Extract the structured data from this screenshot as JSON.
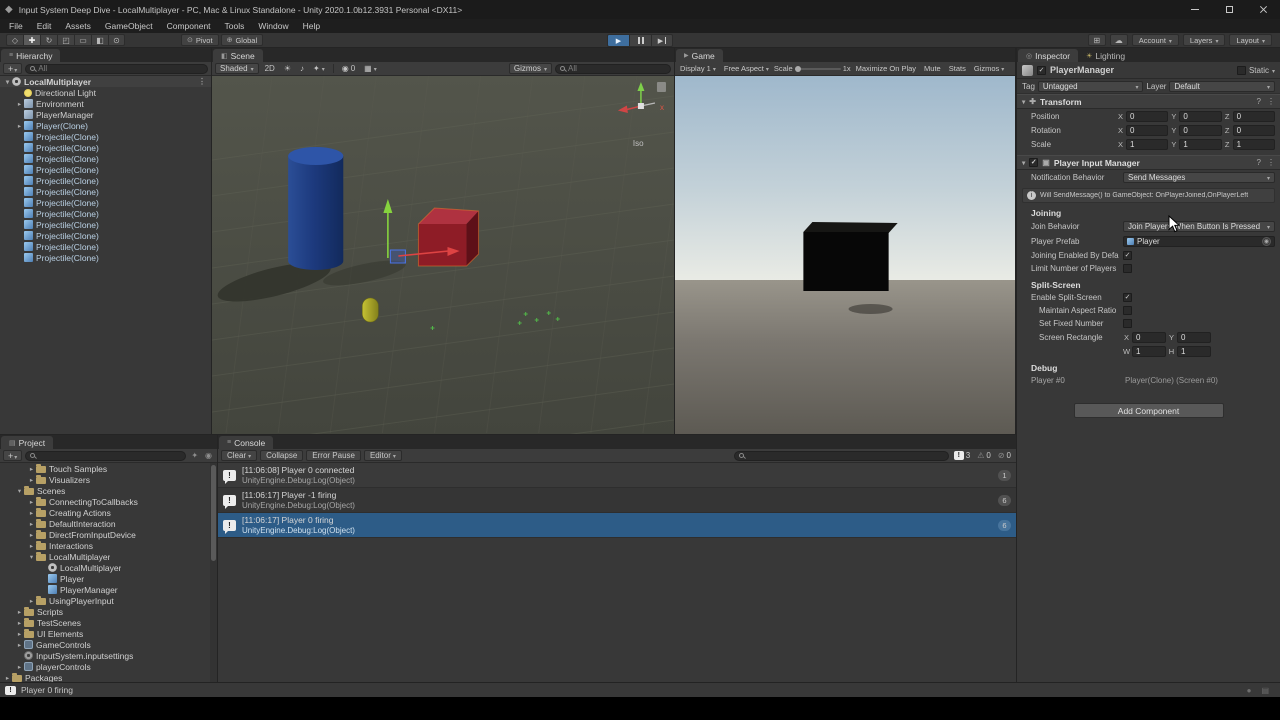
{
  "window": {
    "title": "Input System Deep Dive - LocalMultiplayer - PC, Mac & Linux Standalone - Unity 2020.1.0b12.3931 Personal <DX11>"
  },
  "menubar": {
    "items": [
      {
        "label": "File"
      },
      {
        "label": "Edit"
      },
      {
        "label": "Assets"
      },
      {
        "label": "GameObject"
      },
      {
        "label": "Component"
      },
      {
        "label": "Tools"
      },
      {
        "label": "Window"
      },
      {
        "label": "Help"
      }
    ]
  },
  "toolbar": {
    "pivot": "Pivot",
    "global": "Global",
    "account": "Account",
    "layers": "Layers",
    "layout": "Layout"
  },
  "hierarchy": {
    "tab": "Hierarchy",
    "add_button": "+",
    "search_placeholder": "All",
    "items": [
      {
        "label": "LocalMultiplayer",
        "cls": "ind-0 scene-row",
        "arrow": "a-open",
        "icon": "i-scene"
      },
      {
        "label": "Directional Light",
        "cls": "ind-1",
        "arrow": "a-none",
        "icon": "i-light"
      },
      {
        "label": "Environment",
        "cls": "ind-1",
        "arrow": "a-closed",
        "icon": "i-go"
      },
      {
        "label": "PlayerManager",
        "cls": "ind-1",
        "arrow": "a-none",
        "icon": "i-go"
      },
      {
        "label": "Player(Clone)",
        "cls": "ind-1 ptext",
        "arrow": "a-closed",
        "icon": "i-prefab"
      },
      {
        "label": "Projectile(Clone)",
        "cls": "ind-1 ptext",
        "arrow": "a-none",
        "icon": "i-prefab"
      },
      {
        "label": "Projectile(Clone)",
        "cls": "ind-1 ptext",
        "arrow": "a-none",
        "icon": "i-prefab"
      },
      {
        "label": "Projectile(Clone)",
        "cls": "ind-1 ptext",
        "arrow": "a-none",
        "icon": "i-prefab"
      },
      {
        "label": "Projectile(Clone)",
        "cls": "ind-1 ptext",
        "arrow": "a-none",
        "icon": "i-prefab"
      },
      {
        "label": "Projectile(Clone)",
        "cls": "ind-1 ptext",
        "arrow": "a-none",
        "icon": "i-prefab"
      },
      {
        "label": "Projectile(Clone)",
        "cls": "ind-1 ptext",
        "arrow": "a-none",
        "icon": "i-prefab"
      },
      {
        "label": "Projectile(Clone)",
        "cls": "ind-1 ptext",
        "arrow": "a-none",
        "icon": "i-prefab"
      },
      {
        "label": "Projectile(Clone)",
        "cls": "ind-1 ptext",
        "arrow": "a-none",
        "icon": "i-prefab"
      },
      {
        "label": "Projectile(Clone)",
        "cls": "ind-1 ptext",
        "arrow": "a-none",
        "icon": "i-prefab"
      },
      {
        "label": "Projectile(Clone)",
        "cls": "ind-1 ptext",
        "arrow": "a-none",
        "icon": "i-prefab"
      },
      {
        "label": "Projectile(Clone)",
        "cls": "ind-1 ptext",
        "arrow": "a-none",
        "icon": "i-prefab"
      },
      {
        "label": "Projectile(Clone)",
        "cls": "ind-1 ptext",
        "arrow": "a-none",
        "icon": "i-prefab"
      }
    ]
  },
  "project": {
    "tab": "Project",
    "add_button": "+",
    "items": [
      {
        "label": "Touch Samples",
        "cls": "ind-2",
        "arrow": "a-closed",
        "icon": "i-folder"
      },
      {
        "label": "Visualizers",
        "cls": "ind-2",
        "arrow": "a-closed",
        "icon": "i-folder"
      },
      {
        "label": "Scenes",
        "cls": "ind-1",
        "arrow": "a-open",
        "icon": "i-folder"
      },
      {
        "label": "ConnectingToCallbacks",
        "cls": "ind-2",
        "arrow": "a-closed",
        "icon": "i-folder"
      },
      {
        "label": "Creating Actions",
        "cls": "ind-2",
        "arrow": "a-closed",
        "icon": "i-folder"
      },
      {
        "label": "DefaultInteraction",
        "cls": "ind-2",
        "arrow": "a-closed",
        "icon": "i-folder"
      },
      {
        "label": "DirectFromInputDevice",
        "cls": "ind-2",
        "arrow": "a-closed",
        "icon": "i-folder"
      },
      {
        "label": "Interactions",
        "cls": "ind-2",
        "arrow": "a-closed",
        "icon": "i-folder"
      },
      {
        "label": "LocalMultiplayer",
        "cls": "ind-2",
        "arrow": "a-open",
        "icon": "i-folder"
      },
      {
        "label": "LocalMultiplayer",
        "cls": "ind-3",
        "arrow": "a-none",
        "icon": "i-scene"
      },
      {
        "label": "Player",
        "cls": "ind-3",
        "arrow": "a-none",
        "icon": "i-prefab"
      },
      {
        "label": "PlayerManager",
        "cls": "ind-3",
        "arrow": "a-none",
        "icon": "i-prefab"
      },
      {
        "label": "UsingPlayerInput",
        "cls": "ind-2",
        "arrow": "a-closed",
        "icon": "i-folder"
      },
      {
        "label": "Scripts",
        "cls": "ind-1",
        "arrow": "a-closed",
        "icon": "i-folder"
      },
      {
        "label": "TestScenes",
        "cls": "ind-1",
        "arrow": "a-closed",
        "icon": "i-folder"
      },
      {
        "label": "UI Elements",
        "cls": "ind-1",
        "arrow": "a-closed",
        "icon": "i-folder"
      },
      {
        "label": "GameControls",
        "cls": "ind-1",
        "arrow": "a-closed",
        "icon": "i-asset"
      },
      {
        "label": "InputSystem.inputsettings",
        "cls": "ind-1",
        "arrow": "a-none",
        "icon": "i-gear"
      },
      {
        "label": "playerControls",
        "cls": "ind-1",
        "arrow": "a-closed",
        "icon": "i-asset"
      },
      {
        "label": "Packages",
        "cls": "ind-0",
        "arrow": "a-closed",
        "icon": "i-folder"
      }
    ]
  },
  "scene": {
    "tab": "Scene",
    "shading": "Shaded",
    "mode_2d": "2D",
    "hidden_count": "0",
    "gizmos": "Gizmos",
    "search_placeholder": "All",
    "iso_label": "Iso",
    "axis_x_label": "x"
  },
  "game": {
    "tab": "Game",
    "display": "Display 1",
    "aspect": "Free Aspect",
    "scale_label": "Scale",
    "scale_value": "1x",
    "maximize": "Maximize On Play",
    "mute": "Mute",
    "stats": "Stats",
    "gizmos": "Gizmos"
  },
  "console": {
    "tab": "Console",
    "clear": "Clear",
    "collapse": "Collapse",
    "error_pause": "Error Pause",
    "editor": "Editor",
    "counts": {
      "info": "3",
      "warning": "0",
      "error": "0"
    },
    "logs": [
      {
        "line1": "[11:06:08] Player 0 connected",
        "line2": "UnityEngine.Debug:Log(Object)",
        "count": "1",
        "cls": ""
      },
      {
        "line1": "[11:06:17] Player -1 firing",
        "line2": "UnityEngine.Debug:Log(Object)",
        "count": "6",
        "cls": ""
      },
      {
        "line1": "[11:06:17] Player 0 firing",
        "line2": "UnityEngine.Debug:Log(Object)",
        "count": "6",
        "cls": "selected"
      }
    ]
  },
  "inspector": {
    "tab": "Inspector",
    "tab_lighting": "Lighting",
    "name": "PlayerManager",
    "active_check": "✓",
    "static_label": "Static",
    "static_check": "",
    "tag_label": "Tag",
    "tag_value": "Untagged",
    "layer_label": "Layer",
    "layer_value": "Default",
    "transform": {
      "title": "Transform",
      "axes": {
        "x": "X",
        "y": "Y",
        "z": "Z"
      },
      "rows": [
        {
          "label": "Position",
          "x": "0",
          "y": "0",
          "z": "0"
        },
        {
          "label": "Rotation",
          "x": "0",
          "y": "0",
          "z": "0"
        },
        {
          "label": "Scale",
          "x": "1",
          "y": "1",
          "z": "1"
        }
      ]
    },
    "pim": {
      "title": "Player Input Manager",
      "enabled_check": "✓",
      "notification_label": "Notification Behavior",
      "notification_value": "Send Messages",
      "help_text": "Will SendMessage() to GameObject: OnPlayerJoined,OnPlayerLeft",
      "joining_header": "Joining",
      "join_behavior_label": "Join Behavior",
      "join_behavior_value": "Join Players When Button Is Pressed",
      "player_prefab_label": "Player Prefab",
      "player_prefab_value": "Player",
      "joining_enabled_label": "Joining Enabled By Defa",
      "joining_enabled_check": "✓",
      "limit_players_label": "Limit Number of Players",
      "limit_players_check": "",
      "split_header": "Split-Screen",
      "enable_split_label": "Enable Split-Screen",
      "enable_split_check": "✓",
      "maintain_aspect_label": "Maintain Aspect Ratio",
      "maintain_aspect_check": "",
      "set_fixed_label": "Set Fixed Number",
      "set_fixed_check": "",
      "screen_rect_label": "Screen Rectangle",
      "rect": {
        "x_label": "X",
        "x": "0",
        "y_label": "Y",
        "y": "0",
        "w_label": "W",
        "w": "1",
        "h_label": "H",
        "h": "1"
      },
      "debug_header": "Debug",
      "debug_label": "Player #0",
      "debug_value": "Player(Clone) (Screen #0)"
    },
    "add_component": "Add Component"
  },
  "statusbar": {
    "message": "Player 0 firing"
  }
}
